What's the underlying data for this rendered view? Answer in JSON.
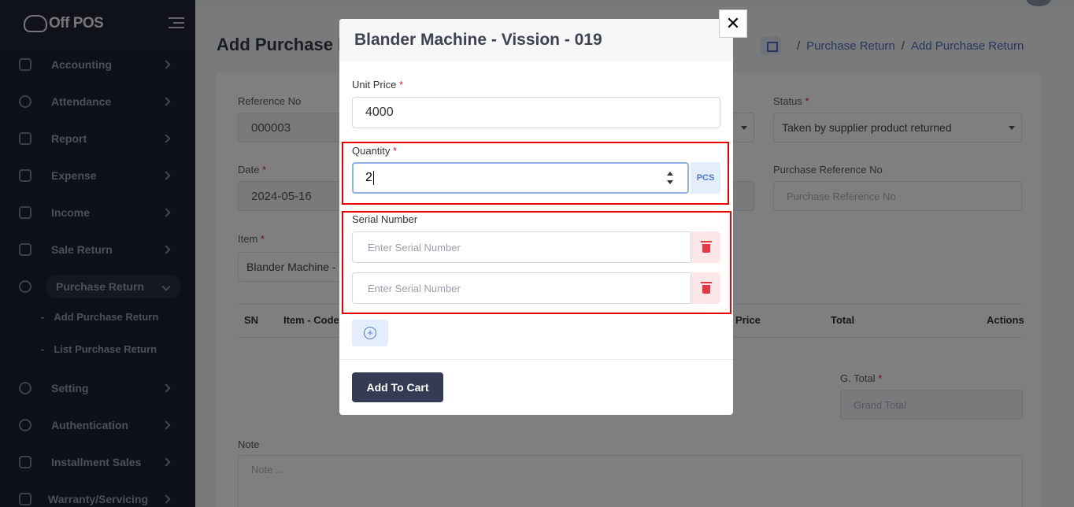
{
  "app": {
    "logo_text": "Off POS"
  },
  "sidebar": {
    "items": [
      {
        "label": "Accounting",
        "icon": "lock-icon"
      },
      {
        "label": "Attendance",
        "icon": "clock-icon"
      },
      {
        "label": "Report",
        "icon": "report-icon"
      },
      {
        "label": "Expense",
        "icon": "expense-icon"
      },
      {
        "label": "Income",
        "icon": "income-icon"
      },
      {
        "label": "Sale Return",
        "icon": "sale-return-icon"
      },
      {
        "label": "Purchase Return",
        "icon": "purchase-return-icon"
      },
      {
        "label": "Setting",
        "icon": "gear-icon"
      },
      {
        "label": "Authentication",
        "icon": "shield-icon"
      },
      {
        "label": "Installment Sales",
        "icon": "layers-icon"
      },
      {
        "label": "Warranty/Servicing",
        "icon": "warranty-icon"
      }
    ],
    "submenu": [
      {
        "label": "Add Purchase Return"
      },
      {
        "label": "List Purchase Return"
      }
    ]
  },
  "page": {
    "title": "Add Purchase R",
    "breadcrumb": [
      "Purchase Return",
      "Add Purchase Return"
    ],
    "form": {
      "reference_no_label": "Reference No",
      "reference_no_value": "000003",
      "status_label": "Status",
      "status_value": "Taken by supplier product returned",
      "date_label": "Date",
      "date_value": "2024-05-16",
      "purchase_ref_label": "Purchase Reference No",
      "purchase_ref_placeholder": "Purchase Reference No",
      "item_label": "Item",
      "item_value": "Blander Machine - ",
      "grand_total_label": "G. Total",
      "grand_total_placeholder": "Grand Total",
      "note_label": "Note",
      "note_placeholder": "Note ..."
    },
    "table_headers": [
      "SN",
      "Item - Code",
      "Price",
      "Total",
      "Actions"
    ]
  },
  "modal": {
    "title": "Blander Machine - Vission - 019",
    "close_glyph": "✕",
    "unit_price_label": "Unit Price",
    "unit_price_value": "4000",
    "quantity_label": "Quantity",
    "quantity_value": "2",
    "unit": "PCS",
    "serial_label": "Serial Number",
    "serial_placeholder": "Enter Serial Number",
    "serial_rows": 2,
    "add_row_glyph": "+",
    "add_to_cart_label": "Add To Cart",
    "required_mark": "*"
  },
  "colors": {
    "sidebar_bg": "#1f2533",
    "primary_button": "#343b55",
    "accent_blue": "#4a7ad1",
    "danger": "#e53948",
    "highlight": "#e00000"
  }
}
